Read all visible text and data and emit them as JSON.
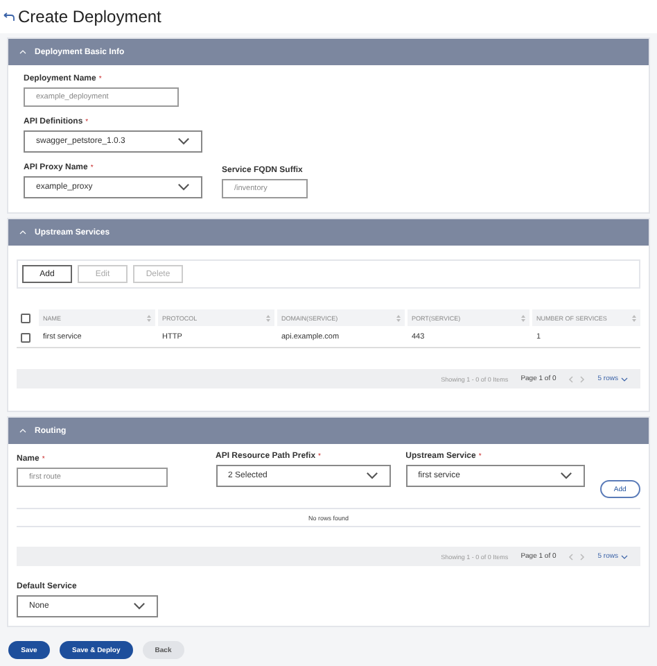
{
  "page": {
    "title": "Create Deployment"
  },
  "basic_info": {
    "header": "Deployment Basic Info",
    "expanded": true,
    "deployment_name": {
      "label": "Deployment Name",
      "marker": "*",
      "placeholder": "example_deployment"
    },
    "api_definitions": {
      "label": "API Definitions",
      "marker": "*",
      "value": "swagger_petstore_1.0.3"
    },
    "api_proxy_name": {
      "label": "API Proxy Name",
      "marker": "*",
      "value": "example_proxy"
    },
    "fqdn_suffix": {
      "label": "Service FQDN Suffix",
      "placeholder": "/inventory"
    }
  },
  "upstream_services": {
    "header": "Upstream Services",
    "expanded": true,
    "buttons": [
      {
        "label": "Add",
        "disabled": false
      },
      {
        "label": "Edit",
        "disabled": true
      },
      {
        "label": "Delete",
        "disabled": true
      }
    ],
    "table": {
      "columns": [
        "NAME",
        "PROTOCOL",
        "DOMAIN(SERVICE)",
        "PORT(SERVICE)",
        "NUMBER OF SERVICES"
      ],
      "all_checked": false,
      "rows": [
        {
          "checked": false,
          "cells": [
            "first service",
            "HTTP",
            "api.example.com",
            "443",
            "1"
          ]
        }
      ]
    },
    "pagination": {
      "showing": "Showing 1 - 0 of 0 Items",
      "page": "Page 1 of 0",
      "rows": "5 rows"
    }
  },
  "routing": {
    "header": "Routing",
    "expanded": true,
    "name": {
      "label": "Name",
      "marker": "*",
      "placeholder": "first route"
    },
    "path_prefix": {
      "label": "API Resource Path Prefix",
      "marker": "*",
      "value": "2 Selected"
    },
    "upstream_service": {
      "label": "Upstream Service",
      "marker": "*",
      "value": "first service"
    },
    "add_button": "Add",
    "empty_message": "No rows found",
    "pagination": {
      "showing": "Showing 1 - 0 of 0 Items",
      "page": "Page 1 of 0",
      "rows": "5 rows"
    },
    "default_service": {
      "label": "Default Service",
      "value": "None"
    }
  },
  "footer": {
    "buttons": [
      {
        "label": "Save",
        "kind": "primary"
      },
      {
        "label": "Save & Deploy",
        "kind": "primary"
      },
      {
        "label": "Back",
        "kind": "secondary"
      }
    ]
  }
}
